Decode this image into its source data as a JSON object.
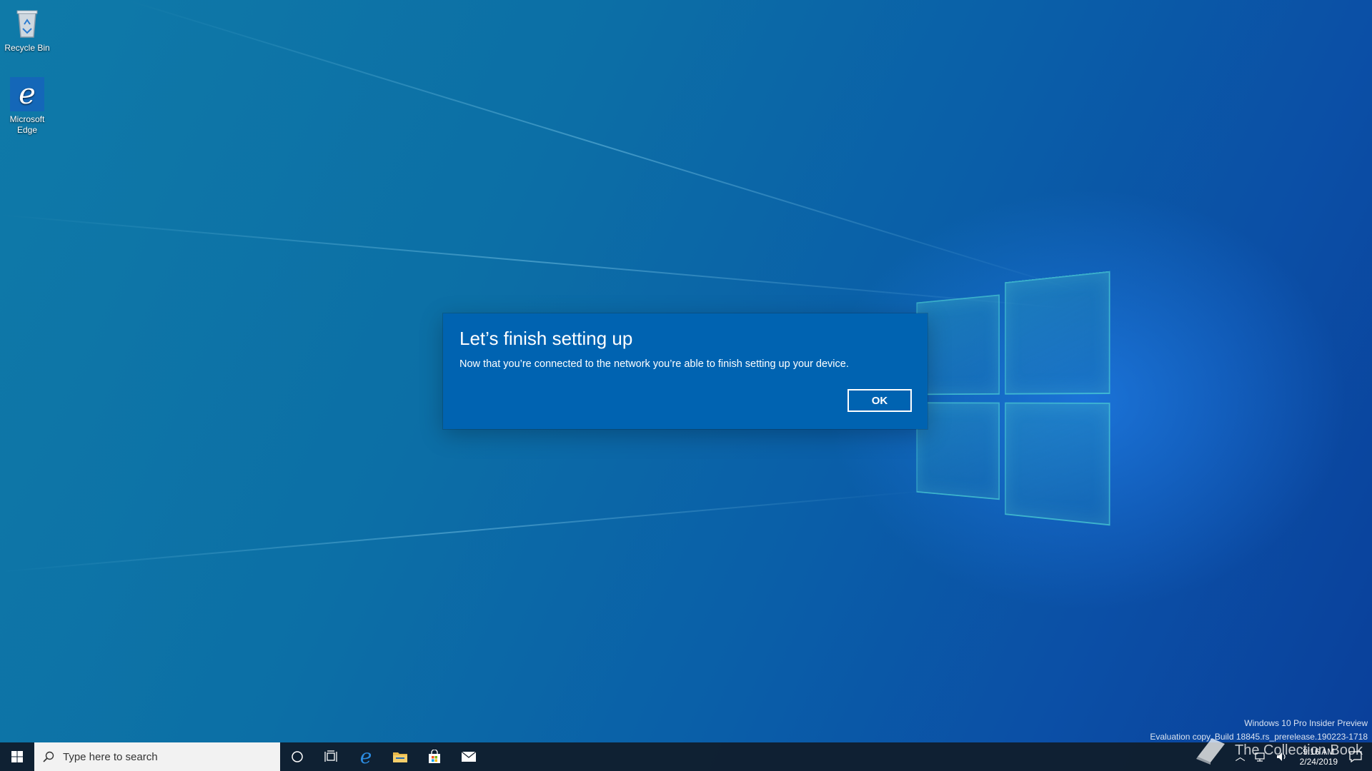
{
  "desktop": {
    "icons": [
      {
        "label": "Recycle Bin",
        "icon": "recycle-bin-icon"
      },
      {
        "label": "Microsoft Edge",
        "icon": "edge-icon"
      }
    ]
  },
  "dialog": {
    "title": "Let’s finish setting up",
    "message": "Now that you’re connected to the network you’re able to finish setting up your device.",
    "ok_label": "OK",
    "accent": "#0063b1"
  },
  "watermark": {
    "line1": "Windows 10 Pro Insider Preview",
    "line2": "Evaluation copy. Build 18845.rs_prerelease.190223-1718"
  },
  "overlay": {
    "brand": "The Collection Book"
  },
  "taskbar": {
    "search_placeholder": "Type here to search",
    "pinned": [
      {
        "name": "cortana",
        "icon": "cortana-circle-icon"
      },
      {
        "name": "task-view",
        "icon": "task-view-icon"
      },
      {
        "name": "edge",
        "icon": "edge-icon"
      },
      {
        "name": "file-explorer",
        "icon": "folder-icon"
      },
      {
        "name": "store",
        "icon": "store-bag-icon"
      },
      {
        "name": "mail",
        "icon": "mail-icon"
      }
    ],
    "clock": {
      "time": "9:16 AM",
      "date": "2/24/2019"
    }
  }
}
